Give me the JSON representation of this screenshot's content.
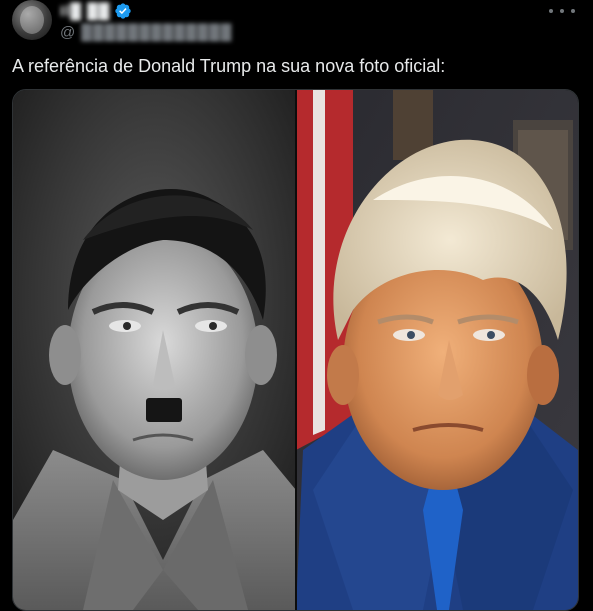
{
  "post": {
    "author": {
      "display_name": "Il█ ██",
      "handle_prefix": "@",
      "handle": "█████████████",
      "verified": true
    },
    "more_icon": "more-horizontal-icon",
    "text": "A referência de Donald Trump na sua nova foto oficial:",
    "media": {
      "left_alt": "black-and-white portrait",
      "right_alt": "color portrait"
    }
  },
  "colors": {
    "background": "#000000",
    "text_primary": "#e7e9ea",
    "text_secondary": "#71767b",
    "verified_blue": "#1d9bf0"
  }
}
